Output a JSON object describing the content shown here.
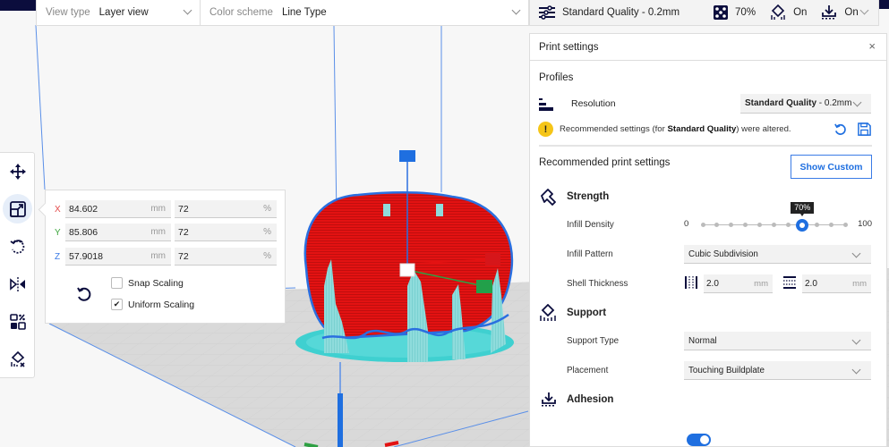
{
  "view_bar": {
    "view_type_label": "View type",
    "view_type_value": "Layer view",
    "color_scheme_label": "Color scheme",
    "color_scheme_value": "Line Type"
  },
  "quality_bar": {
    "profile": "Standard Quality - 0.2mm",
    "infill": "70%",
    "support": "On",
    "adhesion": "On"
  },
  "toolbar": {
    "tools": [
      {
        "name": "move",
        "active": false
      },
      {
        "name": "scale",
        "active": true
      },
      {
        "name": "rotate",
        "active": false
      },
      {
        "name": "mirror",
        "active": false
      },
      {
        "name": "per-model-settings",
        "active": false
      },
      {
        "name": "support-blocker",
        "active": false
      }
    ]
  },
  "scale_panel": {
    "rows": [
      {
        "axis": "X",
        "mm": "84.602",
        "mm_unit": "mm",
        "pct": "72",
        "pct_unit": "%"
      },
      {
        "axis": "Y",
        "mm": "85.806",
        "mm_unit": "mm",
        "pct": "72",
        "pct_unit": "%"
      },
      {
        "axis": "Z",
        "mm": "57.9018",
        "mm_unit": "mm",
        "pct": "72",
        "pct_unit": "%"
      }
    ],
    "snap_scaling": {
      "label": "Snap Scaling",
      "checked": false
    },
    "uniform_scaling": {
      "label": "Uniform Scaling",
      "checked": true,
      "mark": "✔"
    }
  },
  "print_settings": {
    "title": "Print settings",
    "close": "×",
    "profiles_title": "Profiles",
    "resolution_label": "Resolution",
    "resolution_value_bold": "Standard Quality",
    "resolution_value_rest": " - 0.2mm",
    "warning_icon": "!",
    "warning_pre": "Recommended settings (for ",
    "warning_bold": "Standard Quality",
    "warning_post": ") were altered.",
    "recommended_title": "Recommended print settings",
    "show_custom": "Show Custom",
    "strength": {
      "title": "Strength",
      "infill_density_label": "Infill Density",
      "infill_density": {
        "min": "0",
        "max": "100",
        "value": 70,
        "tooltip": "70%",
        "steps": 10
      },
      "infill_pattern_label": "Infill Pattern",
      "infill_pattern": "Cubic Subdivision",
      "shell_thickness_label": "Shell Thickness",
      "wall_thickness": "2.0",
      "top_bottom_thickness": "2.0",
      "unit": "mm"
    },
    "support": {
      "title": "Support",
      "enabled": true,
      "type_label": "Support Type",
      "type": "Normal",
      "placement_label": "Placement",
      "placement": "Touching Buildplate"
    },
    "adhesion": {
      "title": "Adhesion",
      "enabled": true
    }
  },
  "colors": {
    "accent": "#1f6fe0",
    "model_red": "#e31212",
    "support_cyan": "#7fd8d8",
    "warning": "#f5c518"
  }
}
